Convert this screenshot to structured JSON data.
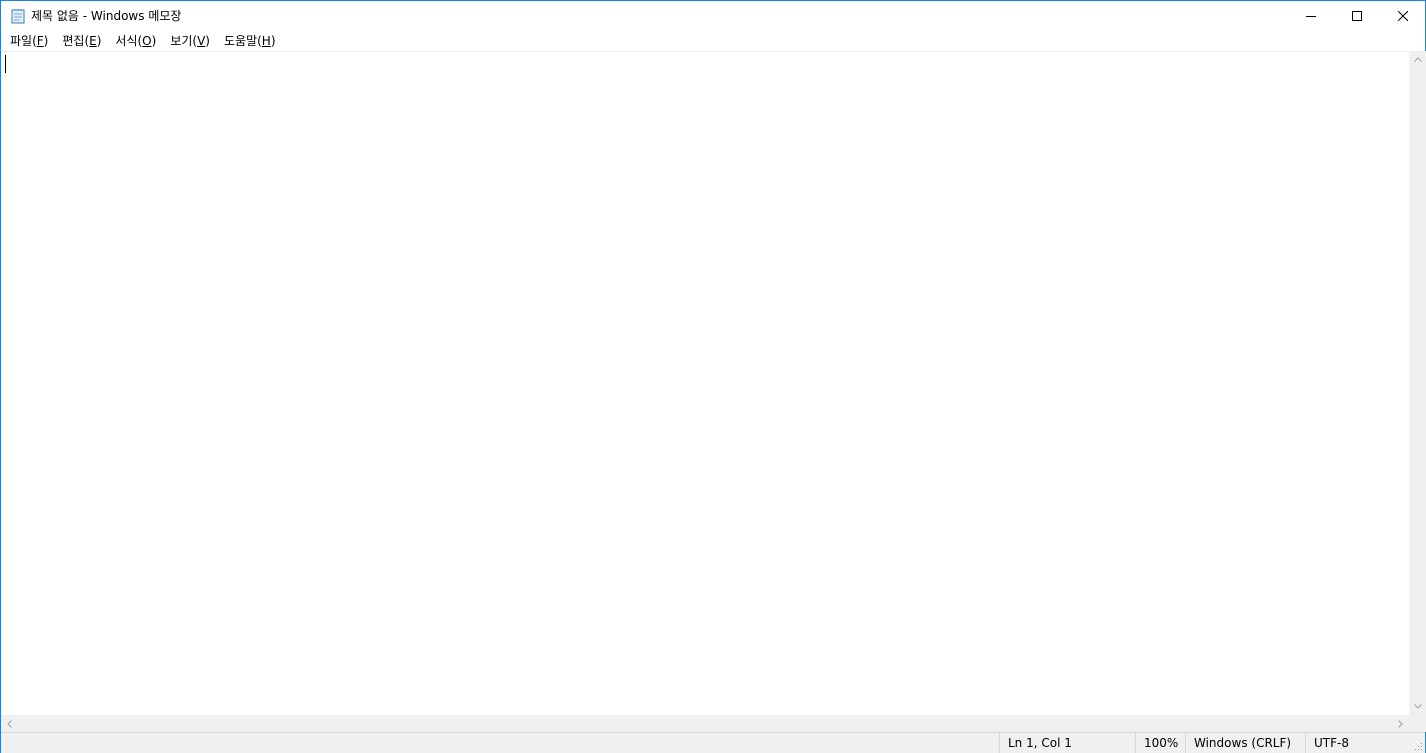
{
  "window": {
    "title": "제목 없음 - Windows 메모장"
  },
  "menu": {
    "items": [
      {
        "label": "파일(",
        "accel": "F",
        "close": ")"
      },
      {
        "label": "편집(",
        "accel": "E",
        "close": ")"
      },
      {
        "label": "서식(",
        "accel": "O",
        "close": ")"
      },
      {
        "label": "보기(",
        "accel": "V",
        "close": ")"
      },
      {
        "label": "도움말(",
        "accel": "H",
        "close": ")"
      }
    ]
  },
  "editor": {
    "content": ""
  },
  "status": {
    "position": "Ln 1, Col 1",
    "zoom": "100%",
    "line_ending": "Windows (CRLF)",
    "encoding": "UTF-8"
  },
  "colors": {
    "border": "#1883d7",
    "chrome": "#f0f0f0"
  },
  "icons": [
    "notepad-icon",
    "minimize-icon",
    "maximize-icon",
    "close-icon",
    "chevron-up-icon",
    "chevron-down-icon",
    "chevron-left-icon",
    "chevron-right-icon",
    "resize-grip-icon"
  ]
}
